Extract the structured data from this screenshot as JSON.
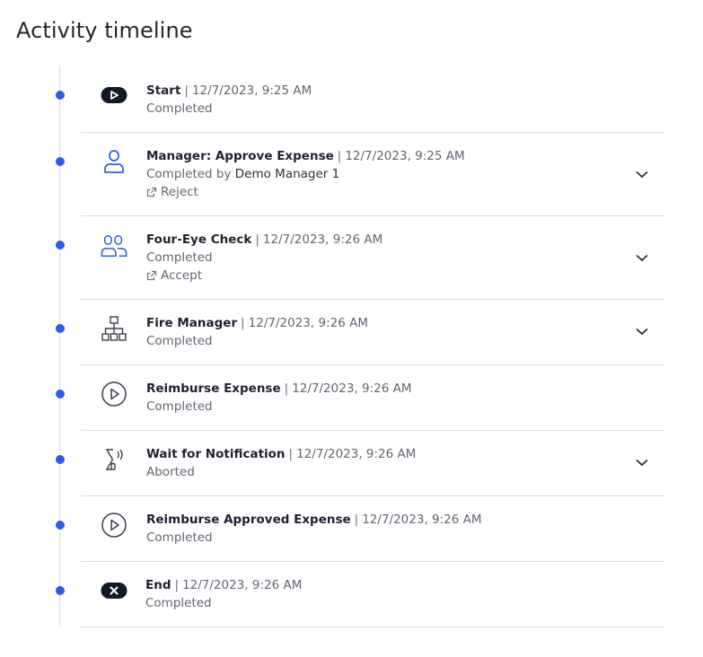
{
  "title": "Activity timeline",
  "separator": "|",
  "accent": "#2f5bea",
  "items": [
    {
      "name": "Start",
      "time": "12/7/2023, 9:25 AM",
      "status": "Completed",
      "icon": "start-badge-icon"
    },
    {
      "name": "Manager: Approve Expense",
      "time": "12/7/2023, 9:25 AM",
      "status": "Completed by",
      "actor": "Demo Manager 1",
      "action": "Reject",
      "icon": "user-icon"
    },
    {
      "name": "Four-Eye Check",
      "time": "12/7/2023, 9:26 AM",
      "status": "Completed",
      "action": "Accept",
      "icon": "users-icon"
    },
    {
      "name": "Fire Manager",
      "time": "12/7/2023, 9:26 AM",
      "status": "Completed",
      "icon": "hierarchy-icon"
    },
    {
      "name": "Reimburse Expense",
      "time": "12/7/2023, 9:26 AM",
      "status": "Completed",
      "icon": "play-circle-icon"
    },
    {
      "name": "Wait for Notification",
      "time": "12/7/2023, 9:26 AM",
      "status": "Aborted",
      "icon": "wait-signal-icon"
    },
    {
      "name": "Reimburse Approved Expense",
      "time": "12/7/2023, 9:26 AM",
      "status": "Completed",
      "icon": "play-circle-icon"
    },
    {
      "name": "End",
      "time": "12/7/2023, 9:26 AM",
      "status": "Completed",
      "icon": "end-badge-icon"
    }
  ]
}
